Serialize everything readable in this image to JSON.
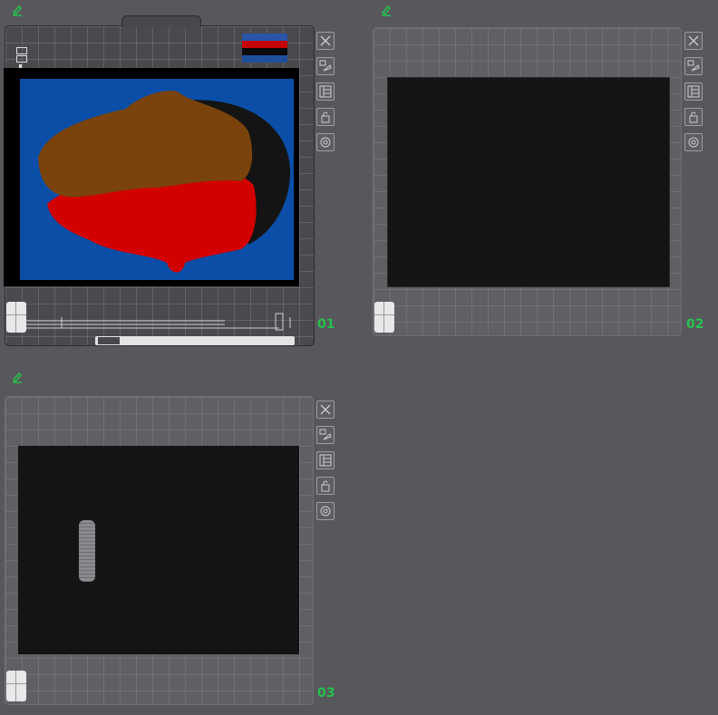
{
  "panels": [
    {
      "id": "01",
      "label": "01"
    },
    {
      "id": "02",
      "label": "02"
    },
    {
      "id": "03",
      "label": "03"
    }
  ],
  "colors": {
    "accent_green": "#26c24d",
    "paint_blue": "#0a4ea8",
    "paint_brown": "#7a430b",
    "paint_red": "#d30000",
    "paint_black": "#141414"
  },
  "icons": [
    "edit-icon",
    "close-icon",
    "swap-icon",
    "layout-icon",
    "lock-icon",
    "settings-icon",
    "grid-icon"
  ]
}
